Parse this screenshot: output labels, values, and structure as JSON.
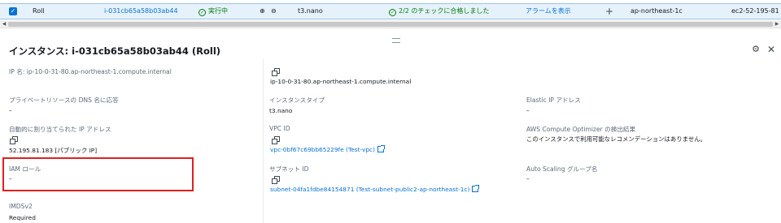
{
  "row": {
    "name": "Roll",
    "instance_id": "i-031cb65a58b03ab44",
    "state": "実行中",
    "type": "t3.nano",
    "status_check": "2/2 のチェックに合格しました",
    "alarm": "アラームを表示",
    "add": "+",
    "az": "ap-northeast-1c",
    "dns": "ec2-52-195-81"
  },
  "panel": {
    "title": "インスタンス: i-031cb65a58b03ab44 (Roll)",
    "fields": {
      "ip_name_label": "IP 名: ip-10-0-31-80.ap-northeast-1.compute.internal",
      "private_dns_value": "ip-10-0-31-80.ap-northeast-1.compute.internal",
      "private_resource_label": "プライベートリソースの DNS 名に応答",
      "private_resource_value": "–",
      "instance_type_label": "インスタンスタイプ",
      "instance_type_value": "t3.nano",
      "elastic_ip_label": "Elastic IP アドレス",
      "elastic_ip_value": "–",
      "auto_ip_label": "自動的に割り当てられた IP アドレス",
      "auto_ip_value": "52.195.81.183 [パブリック IP]",
      "vpc_label": "VPC ID",
      "vpc_value": "vpc-0bf67c69bb65229fe (Test-vpc)",
      "optimizer_label": "AWS Compute Optimizer の検出結果",
      "optimizer_value": "このインスタンスで利用可能なレコメンデーションはありません。",
      "iam_label": "IAM ロール",
      "iam_value": "–",
      "subnet_label": "サブネット ID",
      "subnet_value": "subnet-04fa1fdbe84154871 (Test-subnet-public2-ap-northeast-1c)",
      "asg_label": "Auto Scaling グループ名",
      "asg_value": "–",
      "imds_label": "IMDSv2",
      "imds_value": "Required"
    }
  }
}
